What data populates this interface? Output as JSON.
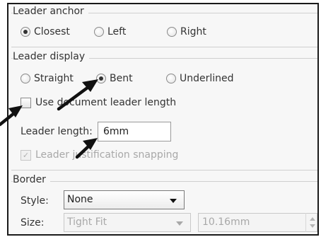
{
  "leader_anchor": {
    "title": "Leader anchor",
    "options": [
      "Closest",
      "Left",
      "Right"
    ],
    "selected": "Closest"
  },
  "leader_display": {
    "title": "Leader display",
    "options": [
      "Straight",
      "Bent",
      "Underlined"
    ],
    "selected": "Bent",
    "use_document_length_label": "Use document leader length",
    "use_document_length_checked": false,
    "leader_length_label": "Leader length:",
    "leader_length_value": "6mm",
    "justification_snapping_label": "Leader justification snapping",
    "justification_snapping_checked": true,
    "justification_snapping_enabled": false,
    "checkmark": "✓"
  },
  "border": {
    "title": "Border",
    "style_label": "Style:",
    "style_value": "None",
    "size_label": "Size:",
    "size_value": "Tight Fit",
    "size_measure": "10.16mm"
  }
}
